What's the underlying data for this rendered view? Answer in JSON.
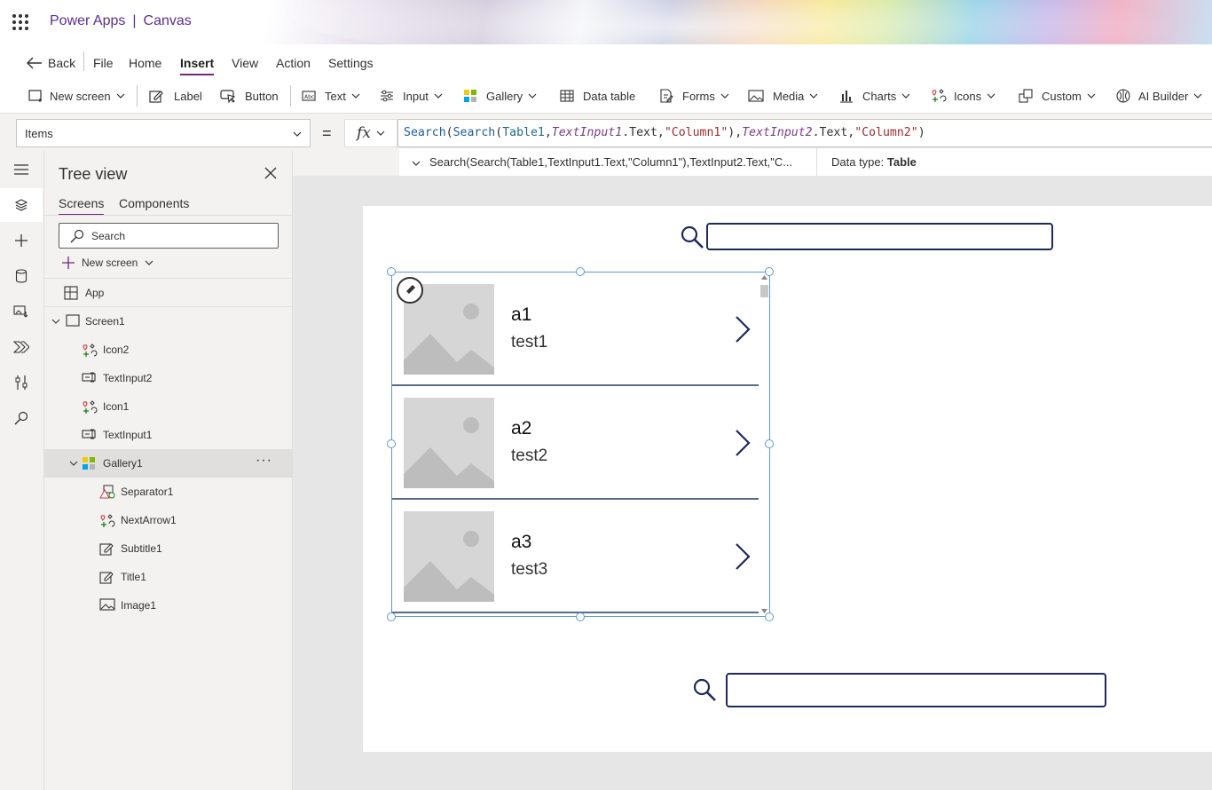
{
  "app": {
    "product": "Power Apps",
    "separator": "|",
    "mode": "Canvas"
  },
  "menu": {
    "back": "Back",
    "items": [
      "File",
      "Home",
      "Insert",
      "View",
      "Action",
      "Settings"
    ],
    "active": "Insert"
  },
  "ribbon": {
    "new_screen": "New screen",
    "label": "Label",
    "button": "Button",
    "text": "Text",
    "input": "Input",
    "gallery": "Gallery",
    "data_table": "Data table",
    "forms": "Forms",
    "media": "Media",
    "charts": "Charts",
    "icons": "Icons",
    "custom": "Custom",
    "ai_builder": "AI Builder"
  },
  "formula_bar": {
    "property": "Items",
    "equals": "=",
    "fx": "fx",
    "tokens": {
      "fn1": "Search",
      "p1": "(",
      "fn2": "Search",
      "p2": "(",
      "tbl": "Table1",
      "c1": ",",
      "ctl1": "TextInput1",
      "dot1": ".Text,",
      "str1": "\"Column1\"",
      "p3": "),",
      "ctl2": "TextInput2",
      "dot2": ".Text,",
      "str2": "\"Column2\"",
      "p4": ")"
    },
    "result_summary": "Search(Search(Table1,TextInput1.Text,\"Column1\"),TextInput2.Text,\"C...",
    "data_type_label": "Data type:",
    "data_type_value": "Table"
  },
  "tree_view": {
    "title": "Tree view",
    "tabs": [
      "Screens",
      "Components"
    ],
    "search_placeholder": "Search",
    "new_screen": "New screen",
    "app": "App",
    "screen": "Screen1",
    "children": [
      "Icon2",
      "TextInput2",
      "Icon1",
      "TextInput1",
      "Gallery1"
    ],
    "gallery_children": [
      "Separator1",
      "NextArrow1",
      "Subtitle1",
      "Title1",
      "Image1"
    ],
    "more": "···"
  },
  "gallery_items": [
    {
      "title": "a1",
      "subtitle": "test1"
    },
    {
      "title": "a2",
      "subtitle": "test2"
    },
    {
      "title": "a3",
      "subtitle": "test3"
    }
  ],
  "colors": {
    "brand": "#5c2d91",
    "accent": "#742774",
    "selection": "#5b9bd5",
    "input_border": "#1e2a5a"
  }
}
